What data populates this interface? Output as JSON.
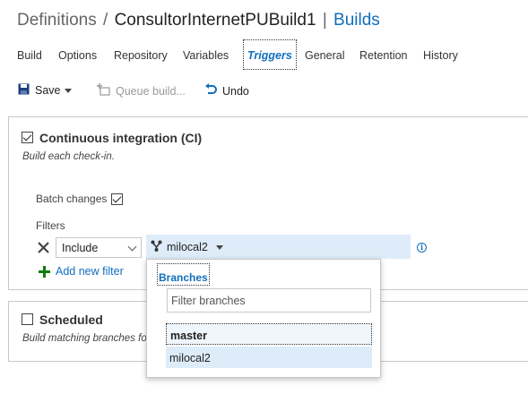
{
  "header": {
    "crumb": "Definitions",
    "separator": "/",
    "definition_name": "ConsultorInternetPUBuild1",
    "pipe": "|",
    "builds_link": "Builds"
  },
  "tabs": [
    {
      "label": "Build"
    },
    {
      "label": "Options"
    },
    {
      "label": "Repository"
    },
    {
      "label": "Variables"
    },
    {
      "label": "Triggers",
      "active": true
    },
    {
      "label": "General"
    },
    {
      "label": "Retention"
    },
    {
      "label": "History"
    }
  ],
  "toolbar": {
    "save_label": "Save",
    "queue_label": "Queue build...",
    "undo_label": "Undo"
  },
  "ci": {
    "checked": true,
    "title": "Continuous integration (CI)",
    "subtitle": "Build each check-in.",
    "batch_label": "Batch changes",
    "batch_checked": true,
    "filters_label": "Filters",
    "filter_type": "Include",
    "branch": "milocal2",
    "add_filter_label": "Add new filter"
  },
  "scheduled": {
    "checked": false,
    "title": "Scheduled",
    "subtitle": "Build matching branches fo"
  },
  "branch_dropdown": {
    "tab_label": "Branches",
    "filter_placeholder": "Filter branches",
    "items": [
      {
        "label": "master",
        "state": "focused"
      },
      {
        "label": "milocal2",
        "state": "selected"
      }
    ]
  },
  "colors": {
    "accent": "#106ebe",
    "selection": "#deecf9",
    "add_icon": "#107c10"
  }
}
